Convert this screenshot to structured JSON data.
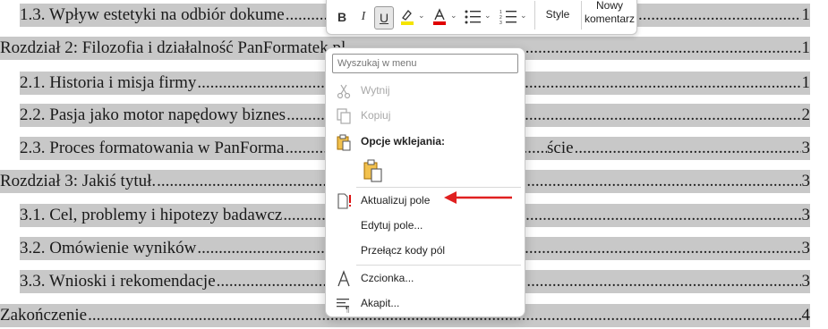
{
  "toc": [
    {
      "title": "1.3. Wpływ estetyki na odbiór dokume",
      "page": "1",
      "level": 2
    },
    {
      "title": "Rozdział 2: Filozofia i działalność PanFormatek.pl",
      "page": "1",
      "level": 1
    },
    {
      "title": "2.1. Historia i misja firmy",
      "page": "1",
      "level": 2
    },
    {
      "title": "2.2. Pasja jako motor napędowy biznes",
      "page": "2",
      "level": 2
    },
    {
      "title": "2.3. Proces formatowania w PanForma",
      "tail": "ście",
      "page": "3",
      "level": 2
    },
    {
      "title": "Rozdział 3: Jakiś tytuł.",
      "page": "3",
      "level": 1
    },
    {
      "title": "3.1. Cel, problemy i hipotezy badawcz",
      "page": "3",
      "level": 2
    },
    {
      "title": "3.2. Omówienie wyników",
      "page": "3",
      "level": 2
    },
    {
      "title": "3.3. Wnioski i rekomendacje",
      "page": "3",
      "level": 2
    },
    {
      "title": "Zakończenie",
      "page": "4",
      "level": 1
    }
  ],
  "dots": "..........................................................................................................................................................................................................................",
  "toolbar": {
    "bold": "B",
    "italic": "I",
    "underline": "U",
    "styles_label": "Style",
    "new_comment_line1": "Nowy",
    "new_comment_line2": "komentarz",
    "highlight_color": "#f5e400",
    "font_color": "#e00000"
  },
  "menu": {
    "search_placeholder": "Wyszukaj w menu",
    "cut": "Wytnij",
    "copy": "Kopiuj",
    "paste_options": "Opcje wklejania:",
    "update_field": "Aktualizuj pole",
    "edit_field": "Edytuj pole...",
    "toggle_field_codes": "Przełącz kody pól",
    "font": "Czcionka...",
    "paragraph": "Akapit..."
  },
  "annotation_color": "#e02020"
}
